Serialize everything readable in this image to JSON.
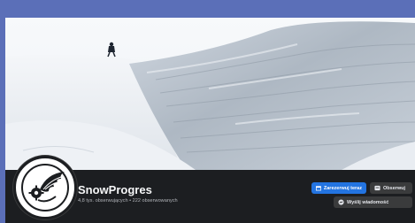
{
  "page": {
    "name": "SnowProgres",
    "stats": "4,8 tys. obserwujących • 222 obserwowanych"
  },
  "actions": {
    "book_now_label": "Zarezerwuj teraz",
    "follow_label": "Obserwuj",
    "message_label": "Wyślij wiadomość"
  },
  "colors": {
    "frame": "#5b6fb8",
    "dark_bar": "#1c1e21",
    "primary_button": "#2374e1",
    "secondary_button": "#3a3b3c"
  },
  "icons": {
    "book": "calendar-icon",
    "follow": "follow-icon",
    "message": "messenger-icon",
    "avatar": "winged-logo-icon"
  }
}
